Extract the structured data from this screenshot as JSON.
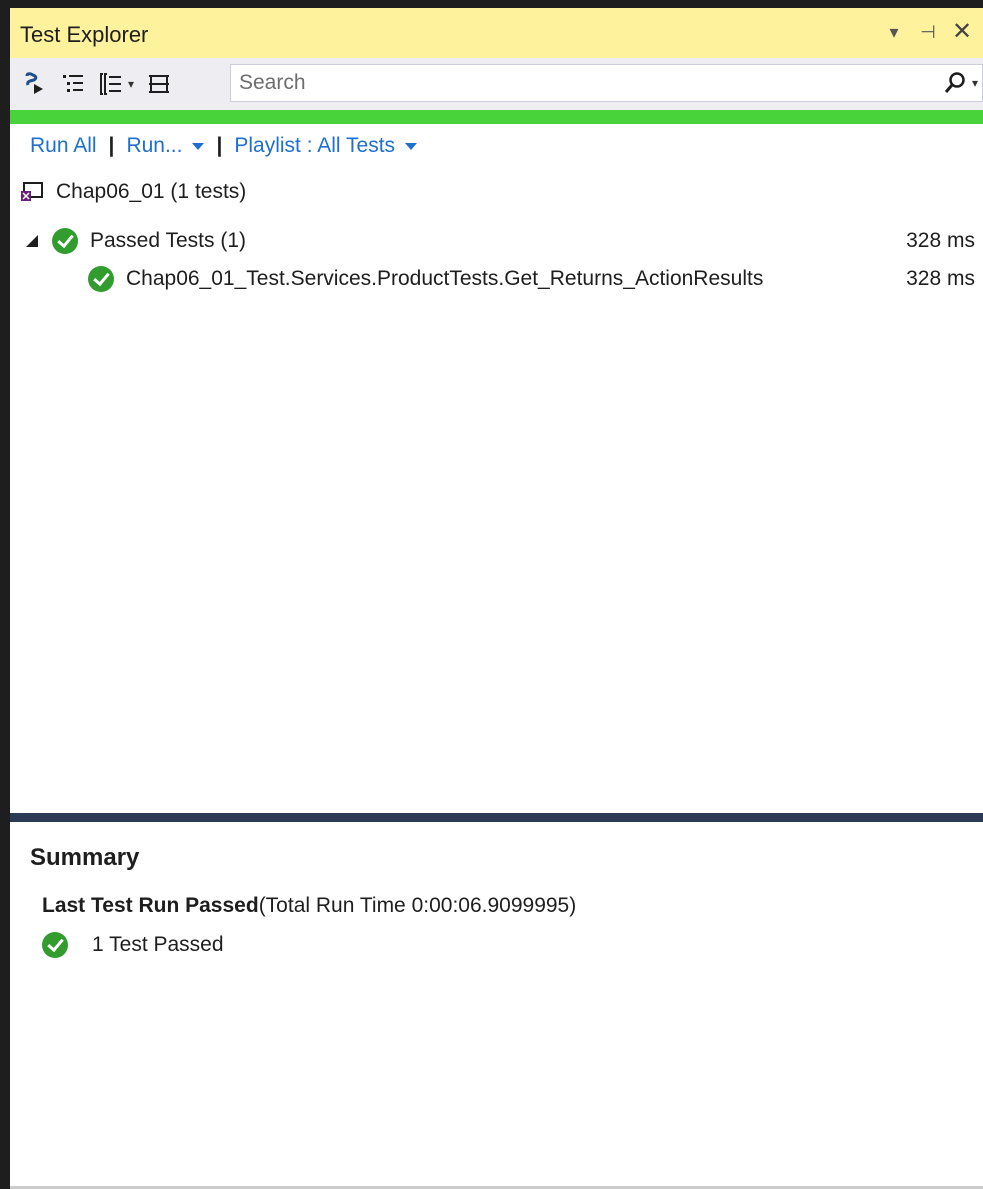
{
  "window": {
    "title": "Test Explorer",
    "controls": {
      "dropdown": "▾",
      "pin": "⊣",
      "close": "✕"
    }
  },
  "toolbar": {
    "icons": [
      "run-tests-icon",
      "group-by-icon",
      "list-view-icon",
      "playlist-icon"
    ],
    "search_placeholder": "Search",
    "search_value": ""
  },
  "status_color": "#48d33a",
  "actions": {
    "run_all": "Run All",
    "separator": "|",
    "run": "Run...",
    "playlist": "Playlist : All Tests"
  },
  "project": {
    "label": "Chap06_01 (1 tests)"
  },
  "groups": [
    {
      "label": "Passed Tests (1)",
      "duration": "328 ms",
      "tests": [
        {
          "name": "Chap06_01_Test.Services.ProductTests.Get_Returns_ActionResults",
          "duration": "328 ms"
        }
      ]
    }
  ],
  "summary": {
    "title": "Summary",
    "last_run_label": "Last Test Run Passed",
    "run_time": "(Total Run Time 0:00:06.9099995)",
    "passed_text": "1 Test Passed"
  }
}
